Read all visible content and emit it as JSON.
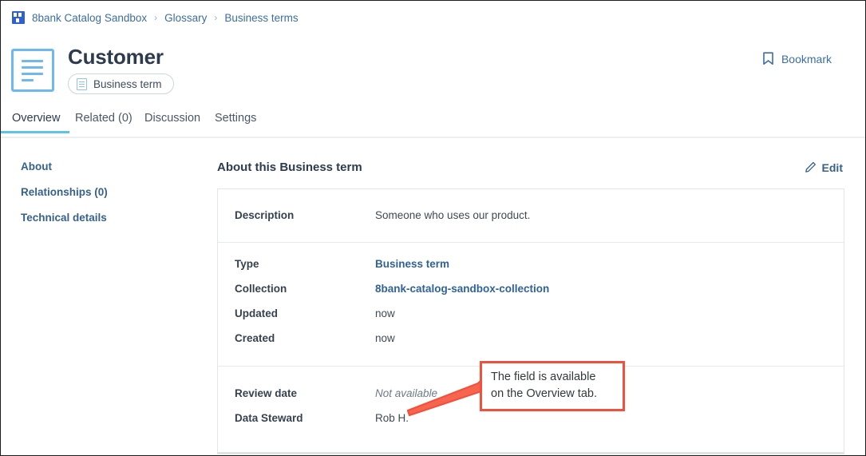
{
  "breadcrumb": {
    "favicon_name": "8bank-favicon",
    "items": [
      {
        "label": "8bank Catalog Sandbox"
      },
      {
        "label": "Glossary"
      },
      {
        "label": "Business terms"
      }
    ],
    "separator": "›"
  },
  "header": {
    "icon_name": "business-term-document-icon",
    "title": "Customer",
    "type_chip": {
      "icon_name": "business-term-chip-icon",
      "label": "Business term"
    },
    "bookmark": {
      "icon_name": "bookmark-icon",
      "label": "Bookmark"
    }
  },
  "tabs": [
    {
      "label": "Overview",
      "active": true
    },
    {
      "label": "Related (0)",
      "active": false
    },
    {
      "label": "Discussion",
      "active": false
    },
    {
      "label": "Settings",
      "active": false
    }
  ],
  "subnav": [
    {
      "label": "About"
    },
    {
      "label": "Relationships (0)"
    },
    {
      "label": "Technical details"
    }
  ],
  "panel": {
    "title": "About this Business term",
    "edit": {
      "icon_name": "pencil-edit-icon",
      "label": "Edit"
    },
    "sections": [
      {
        "rows": [
          {
            "label": "Description",
            "value": "Someone who uses our product.",
            "style": "plain"
          }
        ]
      },
      {
        "rows": [
          {
            "label": "Type",
            "value": "Business term",
            "style": "link"
          },
          {
            "label": "Collection",
            "value": "8bank-catalog-sandbox-collection",
            "style": "link"
          },
          {
            "label": "Updated",
            "value": "now",
            "style": "plain"
          },
          {
            "label": "Created",
            "value": "now",
            "style": "plain"
          }
        ]
      },
      {
        "rows": [
          {
            "label": "Review date",
            "value": "Not available",
            "style": "muted"
          },
          {
            "label": "Data Steward",
            "value": "Rob H.",
            "style": "plain"
          }
        ]
      }
    ]
  },
  "annotation": {
    "text_line_1": "The field is available",
    "text_line_2": "on the Overview tab.",
    "border_color": "#f2503c"
  },
  "colors": {
    "accent_cyan": "#5cc6e0",
    "link_blue": "#36618d",
    "icon_blue": "#6fb8ef",
    "annotation_red": "#f2503c",
    "title_dark": "#2d3b4e"
  }
}
